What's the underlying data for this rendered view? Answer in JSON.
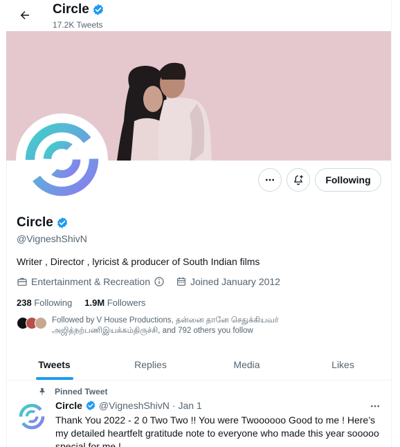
{
  "header": {
    "title": "Circle",
    "tweet_count": "17.2K Tweets"
  },
  "profile": {
    "name": "Circle",
    "handle": "@VigneshShivN",
    "bio": "Writer , Director , lyricist & producer of South Indian films",
    "category": "Entertainment & Recreation",
    "joined": "Joined January 2012",
    "following_count": "238",
    "following_label": "Following",
    "followers_count": "1.9M",
    "followers_label": "Followers",
    "followed_by_line1": "Followed by V House Productions, தன்னை தானே செதுக்கியவர்",
    "followed_by_line2": "அஜித்நற்பணிஇயக்கம்திருச்சி, and 792 others you follow"
  },
  "actions": {
    "follow_label": "Following",
    "more_icon": "more-icon",
    "notify_icon": "bell-plus-icon"
  },
  "tabs": [
    {
      "label": "Tweets",
      "active": true
    },
    {
      "label": "Replies",
      "active": false
    },
    {
      "label": "Media",
      "active": false
    },
    {
      "label": "Likes",
      "active": false
    }
  ],
  "pinned_tweet": {
    "pinned_label": "Pinned Tweet",
    "author_name": "Circle",
    "author_handle": "@VigneshShivN",
    "separator": "·",
    "date": "Jan 1",
    "text": "Thank You 2022 - 2 0 Two Two !! You were Twoooooo Good to me ! Here’s my detailed heartfelt gratitude note to everyone who made this year sooooo special for me !"
  },
  "colors": {
    "accent": "#1d9bf0",
    "banner_bg": "#e4c8cd",
    "secondary_text": "#536471",
    "logo_teal": "#3fd0c9",
    "logo_purple": "#8a7cf0"
  }
}
